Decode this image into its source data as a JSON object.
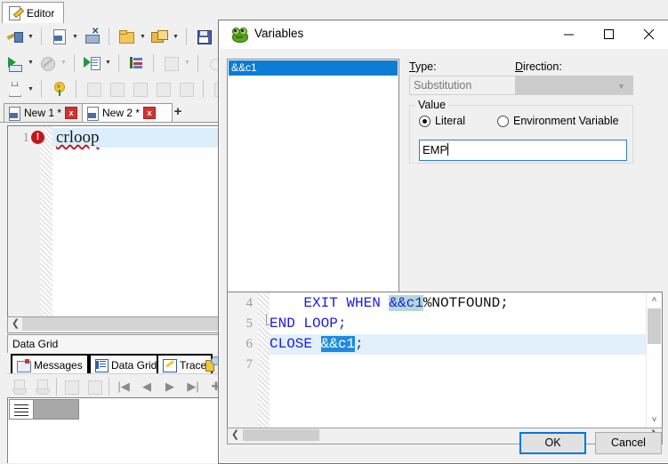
{
  "app": {
    "editor_tab_label": "Editor",
    "toolbar_row1": [
      {
        "name": "connect",
        "icon": "plug-icon",
        "dropdown": true
      },
      {
        "name": "new-sql",
        "icon": "sql-file-icon",
        "dropdown": true
      },
      {
        "name": "disconnect",
        "icon": "disconnect-icon",
        "dropdown": false
      },
      {
        "name": "open-file",
        "icon": "open-folder-icon",
        "dropdown": true
      },
      {
        "name": "open-recent",
        "icon": "folder-refresh-icon",
        "dropdown": true
      },
      {
        "name": "save",
        "icon": "save-icon",
        "dropdown": false
      },
      {
        "name": "save-as",
        "icon": "save-as-icon",
        "dropdown": false
      },
      {
        "name": "save-all",
        "icon": "save-all-icon",
        "dropdown": false
      }
    ],
    "toolbar_row2": [
      {
        "name": "execute-statement",
        "icon": "execute-icon",
        "dropdown": true
      },
      {
        "name": "stop-execution",
        "icon": "stop-icon",
        "dropdown": true
      },
      {
        "name": "execute-script",
        "icon": "execute-script-icon",
        "dropdown": true
      },
      {
        "name": "explain-plan",
        "icon": "explain-plan-icon",
        "dropdown": false
      },
      {
        "name": "auto-trace",
        "icon": "trace-icon",
        "dropdown": true
      },
      {
        "name": "debug",
        "icon": "bug-icon",
        "dropdown": false
      },
      {
        "name": "variables",
        "icon": "variables-icon",
        "dropdown": false
      }
    ],
    "toolbar_row3": [
      {
        "name": "test-script",
        "icon": "flask-icon",
        "dropdown": true
      },
      {
        "name": "formatter",
        "icon": "flower-icon",
        "dropdown": false
      },
      {
        "name": "add-snippet",
        "icon": "add-icon",
        "dropdown": false
      },
      {
        "name": "copy-snippet",
        "icon": "copy-icon",
        "dropdown": false
      },
      {
        "name": "save-snippet",
        "icon": "save-snippet-icon",
        "dropdown": false
      },
      {
        "name": "save-snippet-as",
        "icon": "save-snippet-as-icon",
        "dropdown": false
      },
      {
        "name": "load-snippet",
        "icon": "load-snippet-icon",
        "dropdown": false
      },
      {
        "name": "compare",
        "icon": "compare-icon",
        "dropdown": false
      },
      {
        "name": "duplicate",
        "icon": "duplicate-icon",
        "dropdown": false
      }
    ],
    "doc_tabs": [
      {
        "label": "New 1 *",
        "active": false,
        "close": "x"
      },
      {
        "label": "New 2 *",
        "active": true,
        "close": "x"
      }
    ],
    "new_tab_label": "+",
    "editor": {
      "line_number": "1",
      "error_marker": "!",
      "line_text": "crloop"
    },
    "grid_caption": "Data Grid",
    "grid_tabs": [
      {
        "label": "Messages",
        "icon": "messages-icon",
        "active": false
      },
      {
        "label": "Data Grid",
        "icon": "data-grid-icon",
        "active": true
      },
      {
        "label": "Trace",
        "icon": "trace-icon",
        "active": false
      }
    ],
    "grid_nav": [
      "first-record",
      "prior-record",
      "next-record",
      "last-record",
      "insert-record",
      "delete-record"
    ]
  },
  "dialog": {
    "title": "Variables",
    "icon": "toad-frog-icon",
    "window_buttons": {
      "minimize": "minimize-icon",
      "maximize": "maximize-icon",
      "close": "close-icon"
    },
    "variables_list": [
      "&&c1"
    ],
    "type": {
      "label": "Type:",
      "label_accel": "T",
      "value": "Substitution"
    },
    "direction": {
      "label": "Direction:",
      "label_accel": "D",
      "value": ""
    },
    "value_group": {
      "legend": "Value",
      "radio_literal": "Literal",
      "radio_environment": "Environment Variable",
      "selected": "Literal",
      "input_value": "EMP",
      "input_placeholder": ""
    },
    "code_preview": {
      "lines": [
        {
          "num": "4",
          "prefix": "    ",
          "before": "EXIT WHEN ",
          "highlight": "&&c1",
          "after": "%NOTFOUND;",
          "after_black": true,
          "fold": false,
          "rowhl": false
        },
        {
          "num": "5",
          "prefix": "",
          "before": "END LOOP;",
          "highlight": "",
          "after": "",
          "after_black": false,
          "fold": true,
          "rowhl": false
        },
        {
          "num": "6",
          "prefix": "",
          "before": "CLOSE ",
          "highlight": "&&c1",
          "after": ";",
          "after_black": false,
          "fold": false,
          "rowhl": true
        },
        {
          "num": "7",
          "prefix": "",
          "before": "",
          "highlight": "",
          "after": "",
          "after_black": false,
          "fold": false,
          "rowhl": false
        }
      ]
    },
    "buttons": {
      "ok": "OK",
      "cancel": "Cancel"
    }
  },
  "colors": {
    "selection_blue": "#0c7cd5",
    "focus_blue": "#0078d7",
    "error_red": "#c3161c",
    "code_blue": "#1c1ce0",
    "highlight_teal": "#b4d8d8",
    "row_highlight": "#e2f0fd"
  }
}
